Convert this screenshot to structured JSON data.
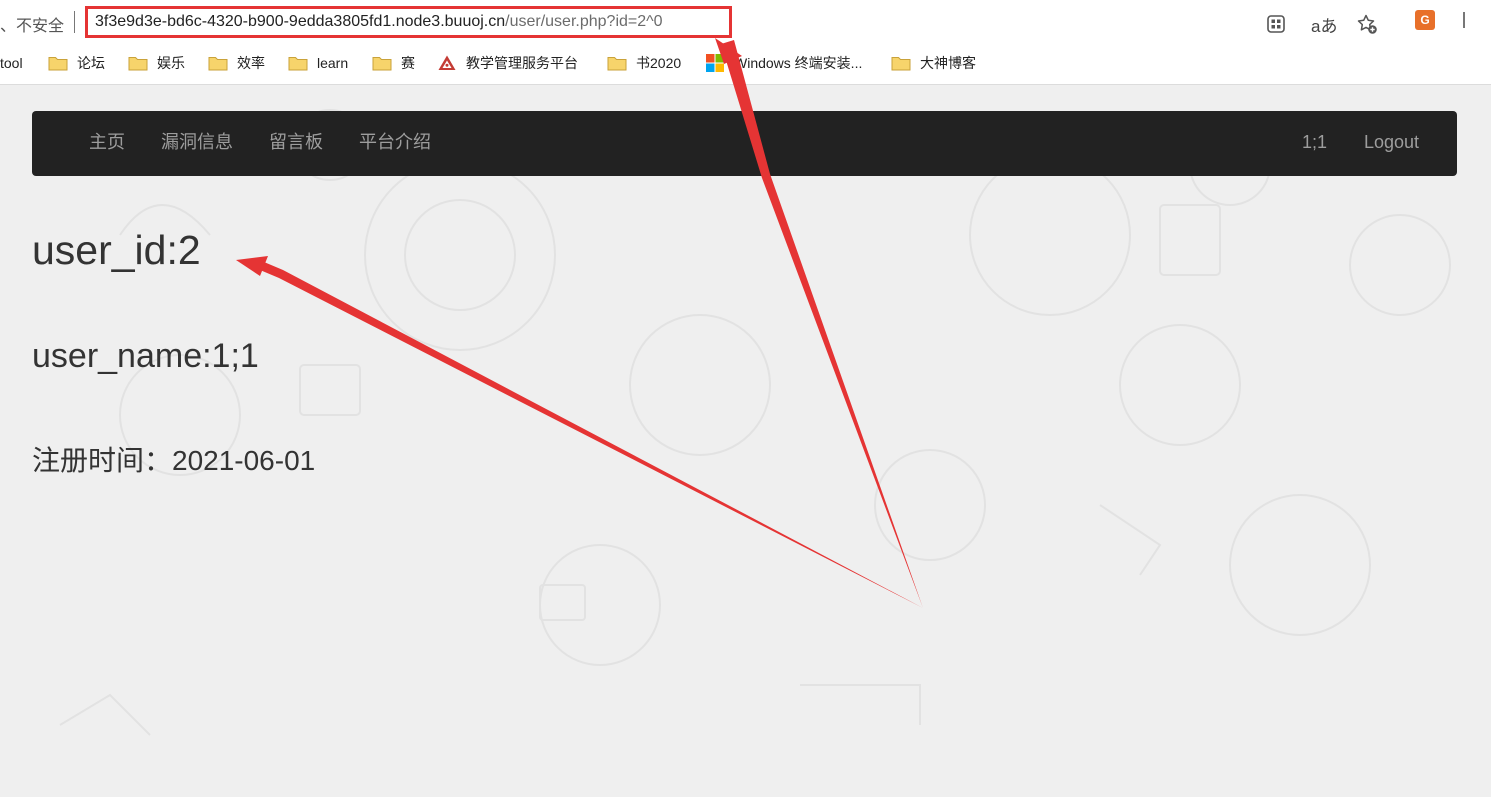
{
  "browser": {
    "security_label": "、不安全",
    "url_host": "3f3e9d3e-bd6c-4320-b900-9edda3805fd1.node3.buuoj.cn",
    "url_path": "/user/user.php?id=2^0",
    "translate_label": "aあ",
    "extension_label": "G",
    "bookmarks": [
      {
        "label": "tool"
      },
      {
        "label": "论坛"
      },
      {
        "label": "娱乐"
      },
      {
        "label": "效率"
      },
      {
        "label": "learn"
      },
      {
        "label": "赛"
      },
      {
        "label": "教学管理服务平台"
      },
      {
        "label": "书2020"
      },
      {
        "label": "Windows 终端安装..."
      },
      {
        "label": "大神博客"
      }
    ]
  },
  "navbar": {
    "items": [
      "主页",
      "漏洞信息",
      "留言板",
      "平台介绍"
    ],
    "username": "1;1",
    "logout": "Logout"
  },
  "profile": {
    "user_id": "user_id:2",
    "user_name": "user_name:1;1",
    "register_time": "注册时间：2021-06-01"
  },
  "colors": {
    "annotation": "#e53434",
    "navbar_bg": "#222222",
    "nav_text": "#9d9d9d"
  }
}
